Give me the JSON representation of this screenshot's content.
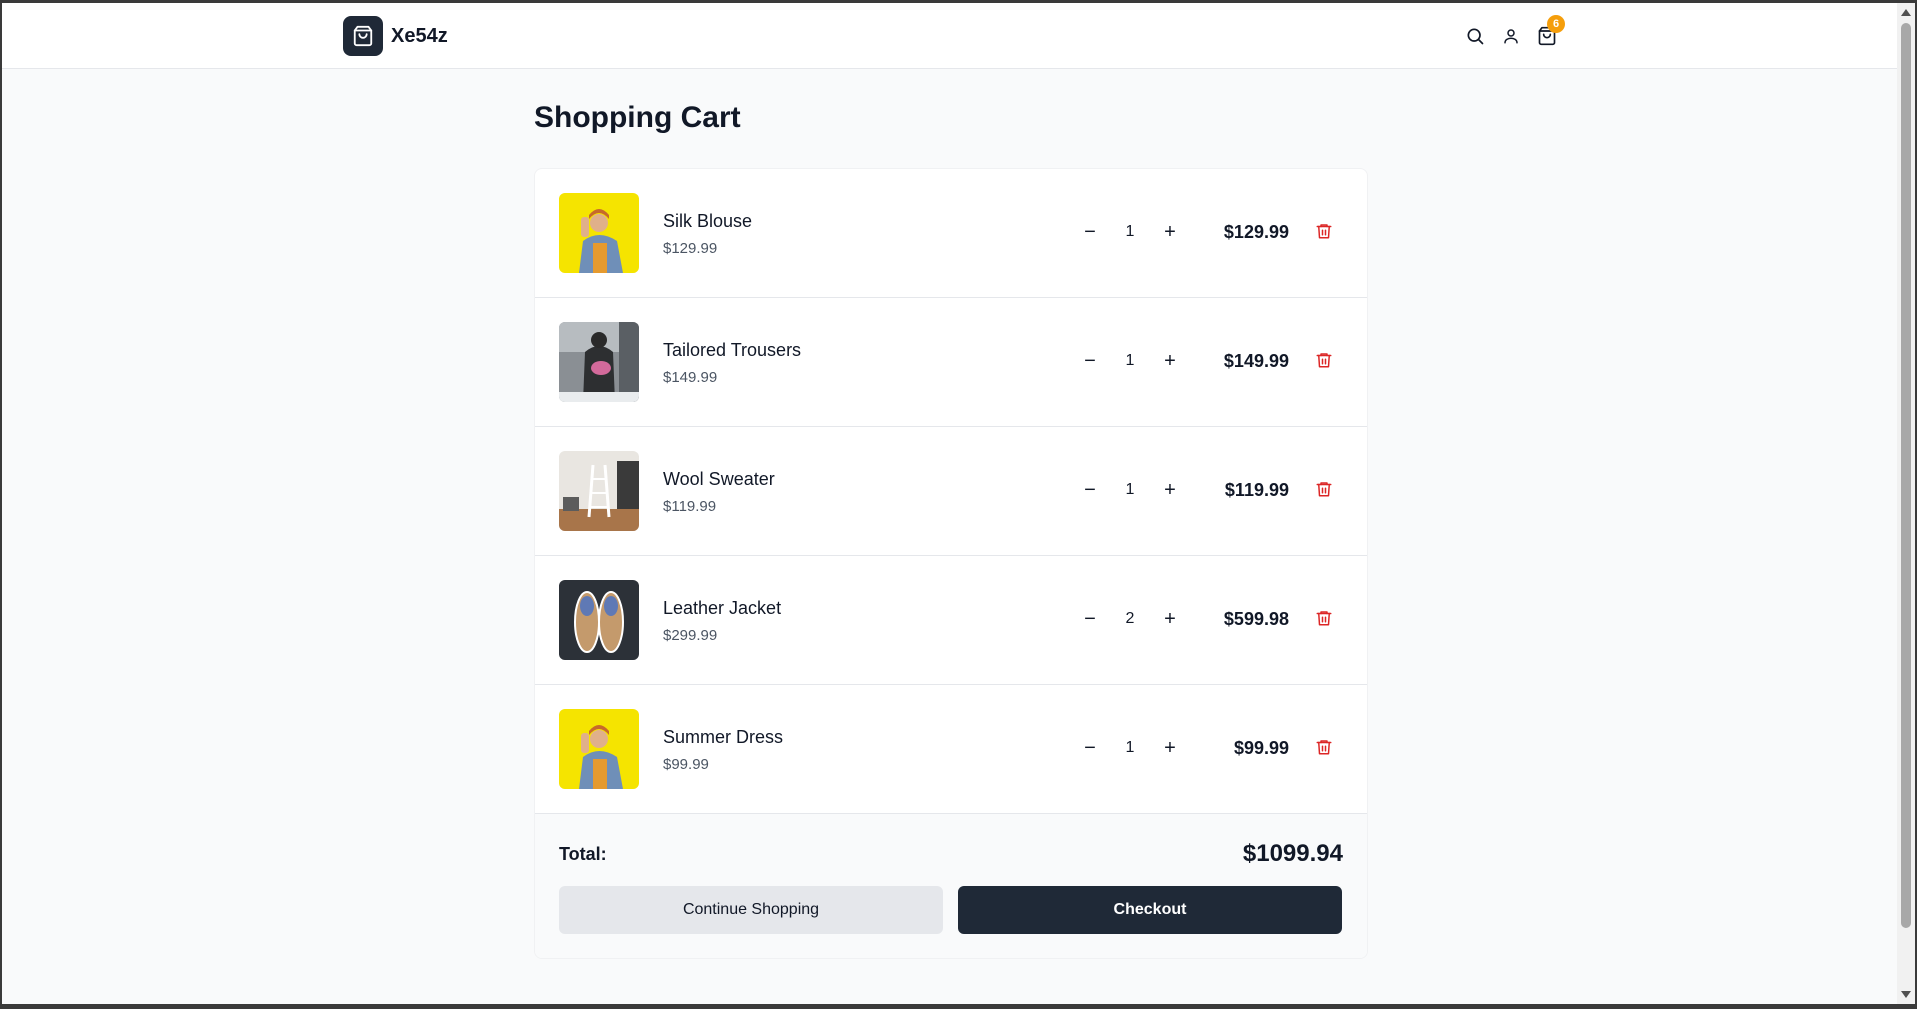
{
  "header": {
    "brand": "Xe54z",
    "cart_count": "6",
    "icons": [
      "shopping-bag-icon",
      "search-icon",
      "user-icon",
      "cart-icon"
    ]
  },
  "page": {
    "title": "Shopping Cart"
  },
  "cart": {
    "items": [
      {
        "name": "Silk Blouse",
        "unit_price": "$129.99",
        "quantity": "1",
        "line_total": "$129.99",
        "image": "woman-yellow-background"
      },
      {
        "name": "Tailored Trousers",
        "unit_price": "$149.99",
        "quantity": "1",
        "line_total": "$149.99",
        "image": "woman-with-pink-bag"
      },
      {
        "name": "Wool Sweater",
        "unit_price": "$119.99",
        "quantity": "1",
        "line_total": "$119.99",
        "image": "room-with-ladder-shelf"
      },
      {
        "name": "Leather Jacket",
        "unit_price": "$299.99",
        "quantity": "2",
        "line_total": "$599.98",
        "image": "pair-of-sneakers"
      },
      {
        "name": "Summer Dress",
        "unit_price": "$99.99",
        "quantity": "1",
        "line_total": "$99.99",
        "image": "woman-yellow-background"
      }
    ],
    "controls": {
      "minus": "−",
      "plus": "+"
    },
    "total_label": "Total:",
    "total_value": "$1099.94",
    "continue_label": "Continue Shopping",
    "checkout_label": "Checkout"
  },
  "colors": {
    "primary": "#1f2937",
    "badge": "#f59e0b",
    "danger": "#dc2626",
    "page_bg": "#f9fafb"
  }
}
